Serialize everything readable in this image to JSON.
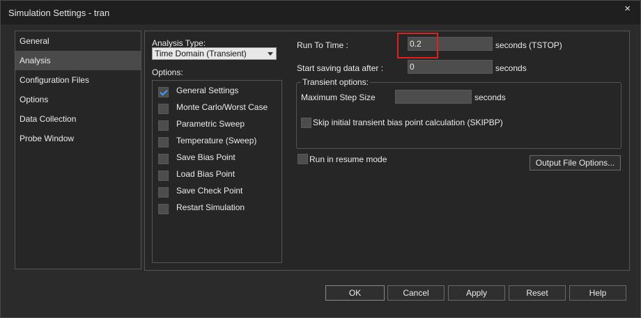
{
  "window": {
    "title": "Simulation Settings - tran",
    "close_glyph": "×"
  },
  "sidebar": {
    "items": [
      {
        "label": "General",
        "active": false
      },
      {
        "label": "Analysis",
        "active": true
      },
      {
        "label": "Configuration Files",
        "active": false
      },
      {
        "label": "Options",
        "active": false
      },
      {
        "label": "Data Collection",
        "active": false
      },
      {
        "label": "Probe Window",
        "active": false
      }
    ]
  },
  "analysis": {
    "type_label": "Analysis Type:",
    "type_value": "Time Domain (Transient)",
    "options_label": "Options:",
    "options": [
      {
        "label": "General Settings",
        "checked": true
      },
      {
        "label": "Monte Carlo/Worst Case",
        "checked": false
      },
      {
        "label": "Parametric Sweep",
        "checked": false
      },
      {
        "label": "Temperature (Sweep)",
        "checked": false
      },
      {
        "label": "Save Bias Point",
        "checked": false
      },
      {
        "label": "Load Bias Point",
        "checked": false
      },
      {
        "label": "Save Check Point",
        "checked": false
      },
      {
        "label": "Restart Simulation",
        "checked": false
      }
    ],
    "run_to_time": {
      "label": "Run To Time :",
      "value": "0.2",
      "unit": "seconds (TSTOP)"
    },
    "start_saving": {
      "label": "Start saving data after :",
      "value": "0",
      "unit": "seconds"
    },
    "transient": {
      "title": "Transient options:",
      "max_step_label": "Maximum Step Size",
      "max_step_value": "",
      "max_step_unit": "seconds",
      "skip_bias_label": "Skip initial transient bias point calculation (SKIPBP)",
      "skip_bias_checked": false
    },
    "resume_mode": {
      "label": "Run in resume mode",
      "checked": false
    },
    "output_file_button": "Output File Options..."
  },
  "buttons": {
    "ok": "OK",
    "cancel": "Cancel",
    "apply": "Apply",
    "reset": "Reset",
    "help": "Help"
  },
  "colors": {
    "accent_check": "#3aa0ff",
    "highlight": "#e02020"
  }
}
